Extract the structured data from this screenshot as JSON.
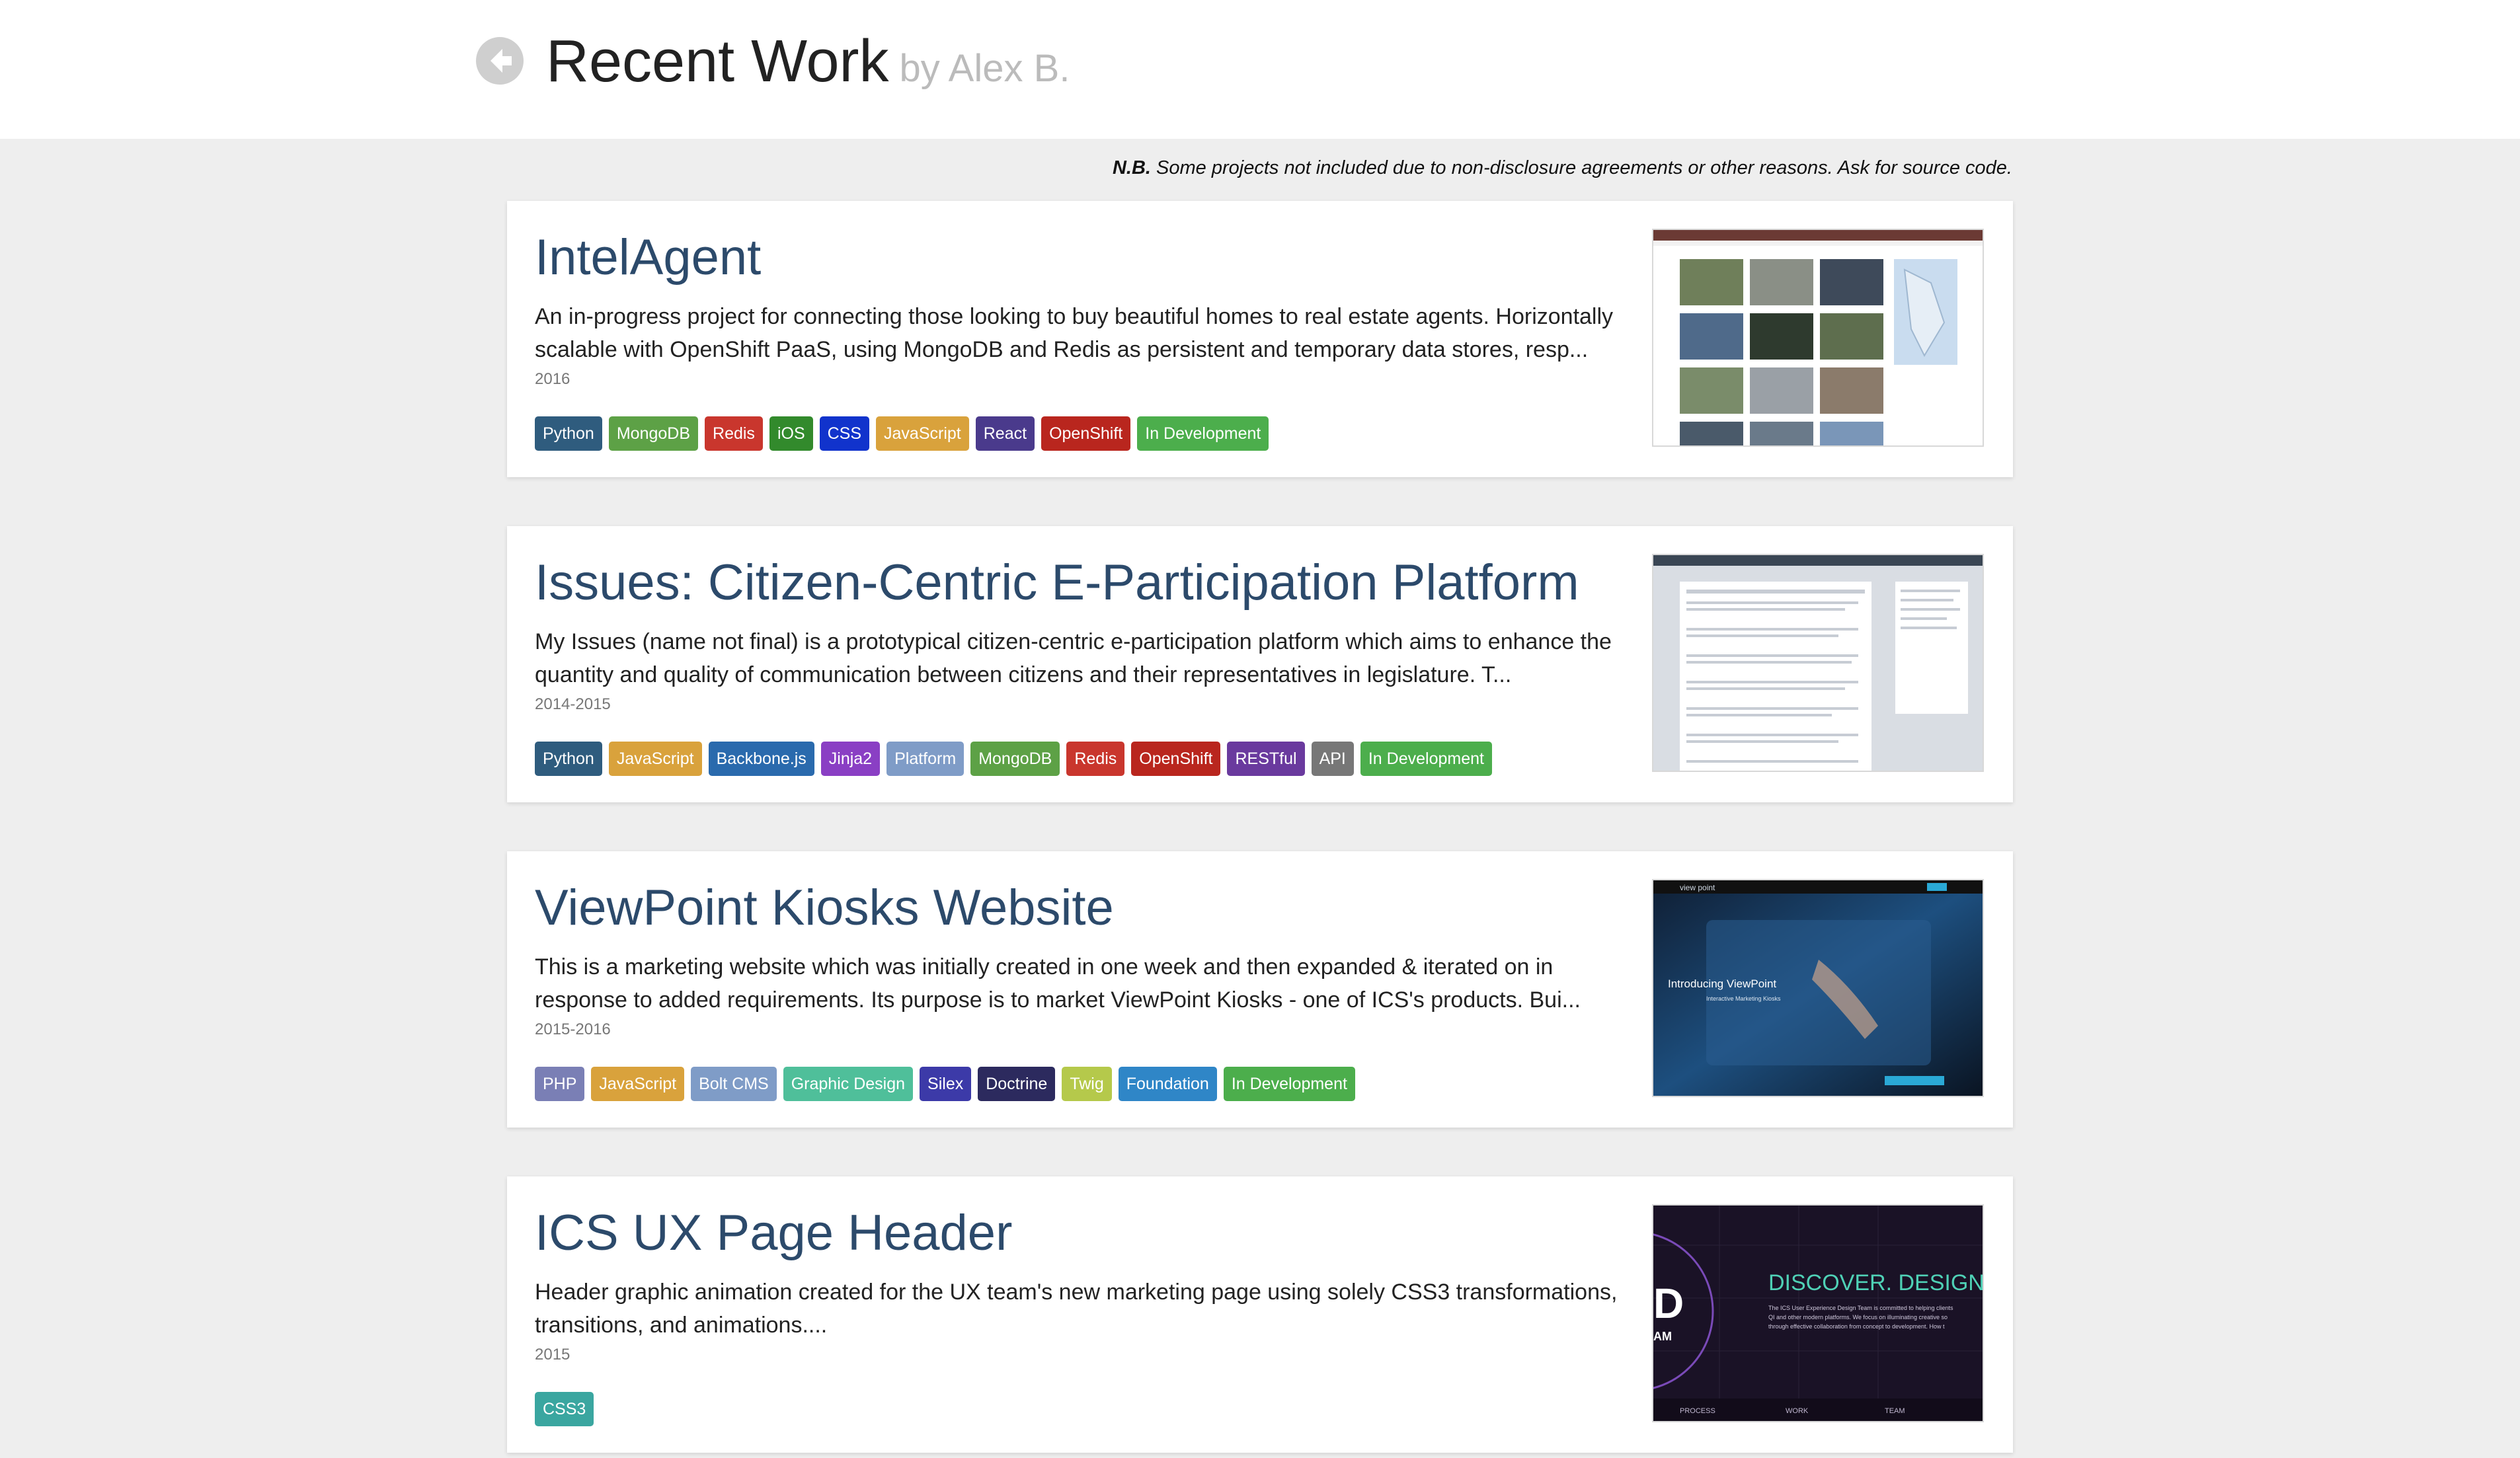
{
  "header": {
    "title": "Recent Work",
    "byline": "by Alex B."
  },
  "disclaimer": {
    "lead": "N.B.",
    "text": " Some projects not included due to non-disclosure agreements or other reasons. Ask for source code."
  },
  "projects": [
    {
      "title": "IntelAgent",
      "description": "An in-progress project for connecting those looking to buy beautiful homes to real estate agents. Horizontally scalable with OpenShift PaaS, using MongoDB and Redis as persistent and temporary data stores, resp...",
      "year": "2016",
      "tags": [
        {
          "label": "Python",
          "color": "#2f5c7e"
        },
        {
          "label": "MongoDB",
          "color": "#5da146"
        },
        {
          "label": "Redis",
          "color": "#c9362d"
        },
        {
          "label": "iOS",
          "color": "#328a2c"
        },
        {
          "label": "CSS",
          "color": "#1133cc"
        },
        {
          "label": "JavaScript",
          "color": "#d9a23c"
        },
        {
          "label": "React",
          "color": "#4a3a8c"
        },
        {
          "label": "OpenShift",
          "color": "#b9261e"
        },
        {
          "label": "In Development",
          "color": "#4cae4c"
        }
      ]
    },
    {
      "title": "Issues: Citizen-Centric E-Participation Platform",
      "description": "My Issues (name not final) is a prototypical citizen-centric e-participation platform which aims to enhance the quantity and quality of communication between citizens and their representatives in legislature. T...",
      "year": "2014-2015",
      "tags": [
        {
          "label": "Python",
          "color": "#2f5c7e"
        },
        {
          "label": "JavaScript",
          "color": "#d9a23c"
        },
        {
          "label": "Backbone.js",
          "color": "#2a6aad"
        },
        {
          "label": "Jinja2",
          "color": "#8a3fc4"
        },
        {
          "label": "Platform",
          "color": "#7f9cc7"
        },
        {
          "label": "MongoDB",
          "color": "#5da146"
        },
        {
          "label": "Redis",
          "color": "#c9362d"
        },
        {
          "label": "OpenShift",
          "color": "#b9261e"
        },
        {
          "label": "RESTful",
          "color": "#6a3a9e"
        },
        {
          "label": "API",
          "color": "#777777"
        },
        {
          "label": "In Development",
          "color": "#4cae4c"
        }
      ]
    },
    {
      "title": "ViewPoint Kiosks Website",
      "description": "This is a marketing website which was initially created in one week and then expanded & iterated on in response to added requirements. Its purpose is to market ViewPoint Kiosks - one of ICS's products. Bui...",
      "year": "2015-2016",
      "tags": [
        {
          "label": "PHP",
          "color": "#7a7fb5"
        },
        {
          "label": "JavaScript",
          "color": "#d9a23c"
        },
        {
          "label": "Bolt CMS",
          "color": "#7f9cc7"
        },
        {
          "label": "Graphic Design",
          "color": "#4fbf9a"
        },
        {
          "label": "Silex",
          "color": "#3c3aa8"
        },
        {
          "label": "Doctrine",
          "color": "#2c2a5e"
        },
        {
          "label": "Twig",
          "color": "#b5c94b"
        },
        {
          "label": "Foundation",
          "color": "#2f86c7"
        },
        {
          "label": "In Development",
          "color": "#4cae4c"
        }
      ]
    },
    {
      "title": "ICS UX Page Header",
      "description": "Header graphic animation created for the UX team's new marketing page using solely CSS3 transformations, transitions, and animations....",
      "year": "2015",
      "tags": [
        {
          "label": "CSS3",
          "color": "#3aa6a0"
        }
      ]
    }
  ],
  "thumbs": {
    "viewpoint": {
      "brand": "view point",
      "headline": "Introducing ViewPoint",
      "subline": "Interactive Marketing Kiosks"
    },
    "ics": {
      "headline": "DISCOVER.  DESIGN",
      "letter": "D",
      "team": "AM",
      "blurb_1": "The ICS User Experience Design Team is committed to helping clients",
      "blurb_2": "QI and other modern platforms. We focus on illuminating creative so",
      "blurb_3": "through effective collaboration from concept to development. How t",
      "nav": [
        "PROCESS",
        "WORK",
        "TEAM"
      ]
    }
  }
}
